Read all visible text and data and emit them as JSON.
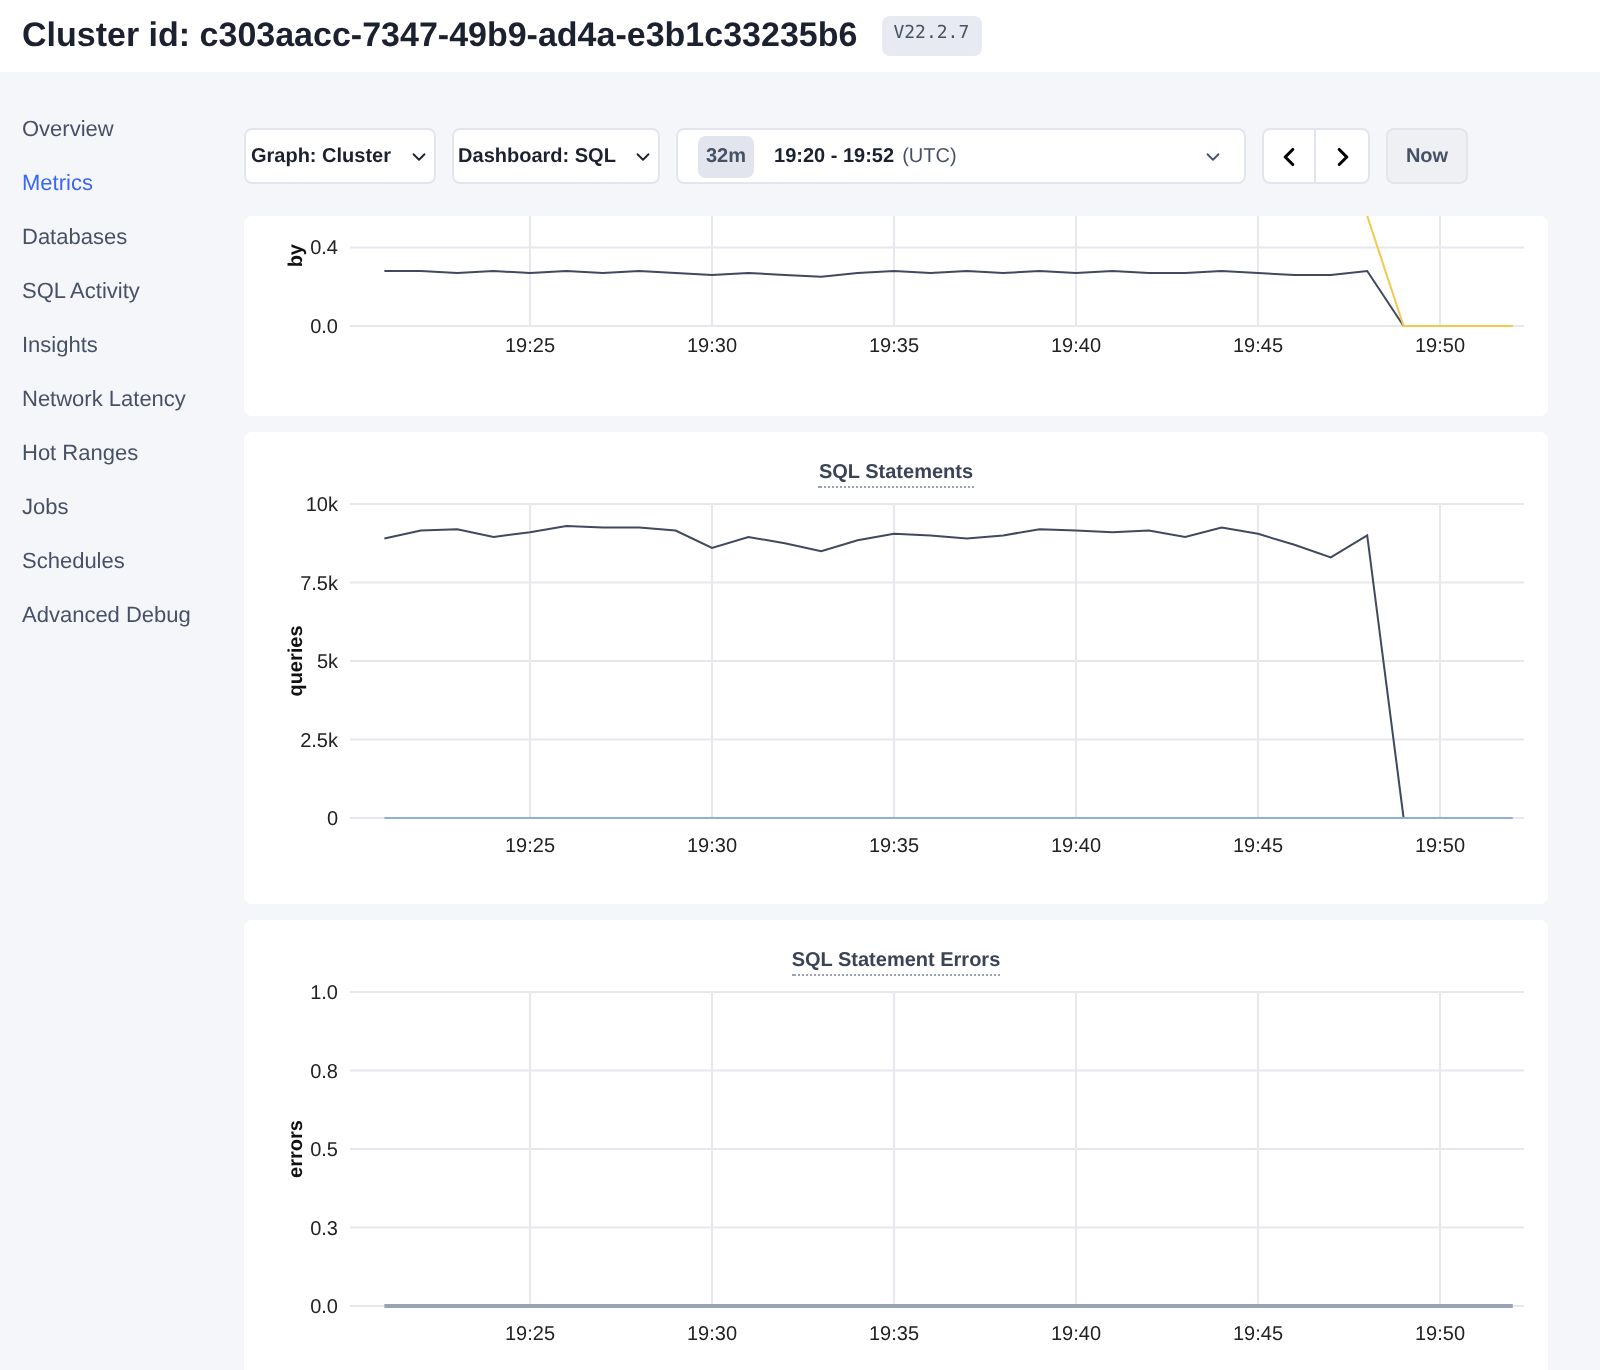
{
  "header": {
    "title": "Cluster id: c303aacc-7347-49b9-ad4a-e3b1c33235b6",
    "version": "V22.2.7"
  },
  "sidebar": {
    "items": [
      {
        "label": "Overview",
        "selected": false
      },
      {
        "label": "Metrics",
        "selected": true
      },
      {
        "label": "Databases",
        "selected": false
      },
      {
        "label": "SQL Activity",
        "selected": false
      },
      {
        "label": "Insights",
        "selected": false
      },
      {
        "label": "Network Latency",
        "selected": false
      },
      {
        "label": "Hot Ranges",
        "selected": false
      },
      {
        "label": "Jobs",
        "selected": false
      },
      {
        "label": "Schedules",
        "selected": false
      },
      {
        "label": "Advanced Debug",
        "selected": false
      }
    ]
  },
  "toolbar": {
    "graph": "Graph: Cluster",
    "dashboard": "Dashboard: SQL",
    "time_range": {
      "duration": "32m",
      "range": "19:20 - 19:52",
      "zone": "(UTC)"
    },
    "now": "Now"
  },
  "charts": [
    {
      "chart_data": {
        "type": "line",
        "grid": true,
        "ylabel": "by",
        "categories": [
          null,
          null,
          null,
          null,
          "19:25",
          null,
          null,
          null,
          null,
          "19:30",
          null,
          null,
          null,
          null,
          "19:35",
          null,
          null,
          null,
          null,
          "19:40",
          null,
          null,
          null,
          null,
          "19:45",
          null,
          null,
          null,
          null,
          "19:50",
          null,
          null
        ],
        "series": [
          {
            "color": "#3f4a5e",
            "values": [
              0.28,
              0.28,
              0.27,
              0.28,
              0.27,
              0.28,
              0.27,
              0.28,
              0.27,
              0.26,
              0.27,
              0.26,
              0.25,
              0.27,
              0.28,
              0.27,
              0.28,
              0.27,
              0.28,
              0.27,
              0.28,
              0.27,
              0.27,
              0.28,
              0.27,
              0.26,
              0.26,
              0.28,
              0,
              null,
              null,
              null
            ]
          },
          {
            "color": "#f2c94c",
            "values": [
              null,
              null,
              null,
              null,
              null,
              null,
              null,
              null,
              null,
              null,
              null,
              null,
              null,
              null,
              null,
              null,
              null,
              null,
              null,
              null,
              null,
              null,
              null,
              null,
              null,
              null,
              null,
              0.56,
              0,
              0,
              0,
              0
            ]
          }
        ],
        "ylim": [
          0,
          0.56
        ],
        "yticks": [
          {
            "value": 0,
            "label": "0.0"
          },
          {
            "value": 0.4,
            "label": "0.4"
          }
        ]
      }
    },
    {
      "chart_data": {
        "type": "line",
        "grid": true,
        "title": "SQL Statements",
        "ylabel": "queries",
        "categories": [
          null,
          null,
          null,
          null,
          "19:25",
          null,
          null,
          null,
          null,
          "19:30",
          null,
          null,
          null,
          null,
          "19:35",
          null,
          null,
          null,
          null,
          "19:40",
          null,
          null,
          null,
          null,
          "19:45",
          null,
          null,
          null,
          null,
          "19:50",
          null,
          null
        ],
        "series": [
          {
            "color": "#3f4a5e",
            "values": [
              8900,
              9150,
              9200,
              8950,
              9100,
              9300,
              9250,
              9250,
              9150,
              8600,
              8950,
              8750,
              8500,
              8850,
              9050,
              9000,
              8900,
              9000,
              9200,
              9150,
              9100,
              9150,
              8950,
              9250,
              9050,
              8700,
              8300,
              9000,
              0,
              null,
              null,
              null
            ]
          },
          {
            "color": "#8fb0d6",
            "values": [
              0,
              0,
              0,
              0,
              0,
              0,
              0,
              0,
              0,
              0,
              0,
              0,
              0,
              0,
              0,
              0,
              0,
              0,
              0,
              0,
              0,
              0,
              0,
              0,
              0,
              0,
              0,
              0,
              0,
              0,
              0,
              0
            ]
          }
        ],
        "ylim": [
          0,
          10000
        ],
        "yticks": [
          {
            "value": 0,
            "label": "0"
          },
          {
            "value": 2500,
            "label": "2.5k"
          },
          {
            "value": 5000,
            "label": "5k"
          },
          {
            "value": 7500,
            "label": "7.5k"
          },
          {
            "value": 10000,
            "label": "10k"
          }
        ]
      }
    },
    {
      "chart_data": {
        "type": "line",
        "grid": true,
        "title": "SQL Statement Errors",
        "ylabel": "errors",
        "categories": [
          null,
          null,
          null,
          null,
          "19:25",
          null,
          null,
          null,
          null,
          "19:30",
          null,
          null,
          null,
          null,
          "19:35",
          null,
          null,
          null,
          null,
          "19:40",
          null,
          null,
          null,
          null,
          "19:45",
          null,
          null,
          null,
          null,
          "19:50",
          null,
          null
        ],
        "series": [
          {
            "color": "#9aa3b5",
            "values": [
              0,
              0,
              0,
              0,
              0,
              0,
              0,
              0,
              0,
              0,
              0,
              0,
              0,
              0,
              0,
              0,
              0,
              0,
              0,
              0,
              0,
              0,
              0,
              0,
              0,
              0,
              0,
              0,
              0,
              0,
              0,
              0
            ]
          }
        ],
        "ylim": [
          0,
          1
        ],
        "yticks": [
          {
            "value": 0,
            "label": "0.0"
          },
          {
            "value": 0.25,
            "label": "0.3"
          },
          {
            "value": 0.5,
            "label": "0.5"
          },
          {
            "value": 0.75,
            "label": "0.8"
          },
          {
            "value": 1,
            "label": "1.0"
          }
        ]
      }
    }
  ]
}
